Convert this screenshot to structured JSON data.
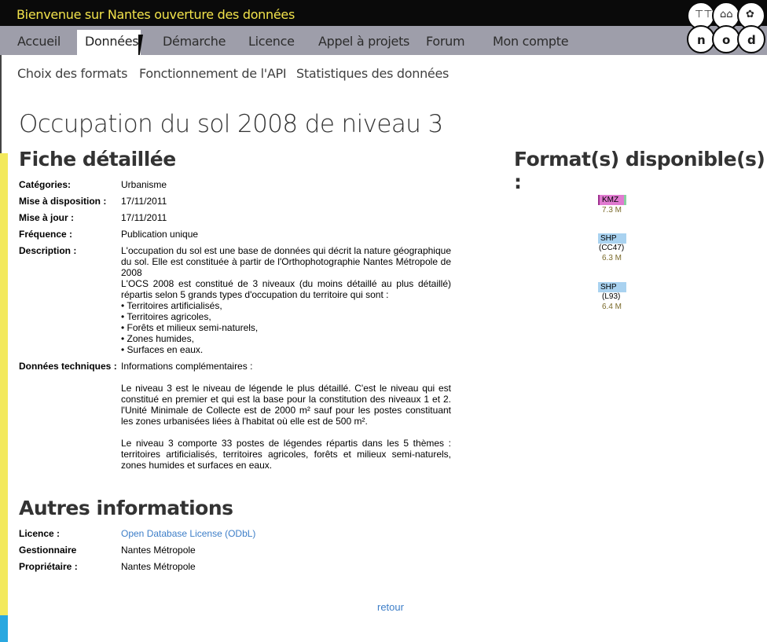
{
  "header": {
    "site_title": "Bienvenue sur Nantes ouverture des données",
    "logo_letters": [
      "n",
      "o",
      "d"
    ]
  },
  "nav": {
    "items": [
      {
        "label": "Accueil"
      },
      {
        "label": "Données",
        "active": true
      },
      {
        "label": "Démarche"
      },
      {
        "label": "Licence"
      },
      {
        "label": "Appel à projets"
      },
      {
        "label": "Forum"
      },
      {
        "label": "Mon compte"
      }
    ]
  },
  "subnav": {
    "items": [
      {
        "label": "Choix des formats"
      },
      {
        "label": "Fonctionnement de l'API"
      },
      {
        "label": "Statistiques des données"
      }
    ]
  },
  "page": {
    "title": "Occupation du sol 2008 de niveau 3",
    "detail_heading": "Fiche détaillée",
    "formats_heading": "Format(s) disponible(s) :",
    "other_heading": "Autres informations"
  },
  "details": {
    "categories_label": "Catégories:",
    "categories_value": "Urbanisme",
    "mise_disposition_label": "Mise à disposition :",
    "mise_disposition_value": "17/11/2011",
    "mise_a_jour_label": "Mise à jour :",
    "mise_a_jour_value": "17/11/2011",
    "frequence_label": "Fréquence :",
    "frequence_value": "Publication unique",
    "description_label": "Description :",
    "description_p1": "L'occupation du sol est une base de données qui décrit la nature géographique du sol. Elle est constituée à partir de l'Orthophotographie Nantes Métropole de 2008",
    "description_p2": "L'OCS 2008 est constitué de 3 niveaux (du moins détaillé au plus détaillé) répartis selon 5 grands types d'occupation du territoire qui sont :",
    "description_list": [
      "• Territoires artificialisés,",
      "• Territoires agricoles,",
      "• Forêts et milieux semi-naturels,",
      "• Zones humides,",
      "• Surfaces en eaux."
    ],
    "tech_label": "Données techniques :",
    "tech_intro": "Informations complémentaires :",
    "tech_p1": "Le niveau 3 est le niveau de légende le plus détaillé. C'est le niveau qui est constitué en premier et qui est la base pour la constitution des niveaux 1 et 2. l'Unité Minimale de Collecte est de 2000 m² sauf pour les postes constituant les zones urbanisées liées à l'habitat où elle est de 500 m².",
    "tech_p2": "Le niveau 3 comporte 33 postes de légendes répartis dans les 5 thèmes : territoires artificialisés, territoires agricoles, forêts et milieux semi-naturels, zones humides et surfaces en eaux."
  },
  "other": {
    "licence_label": "Licence :",
    "licence_value": "Open Database License (ODbL)",
    "gestionnaire_label": "Gestionnaire",
    "gestionnaire_value": "Nantes Métropole",
    "proprietaire_label": "Propriétaire :",
    "proprietaire_value": "Nantes Métropole"
  },
  "formats": [
    {
      "name": "KMZ",
      "sub": "",
      "size": "7.3 M",
      "color": "#e07ad0"
    },
    {
      "name": "SHP",
      "sub": "(CC47)",
      "size": "6.3 M",
      "color": "#a9d2f0"
    },
    {
      "name": "SHP",
      "sub": "(L93)",
      "size": "6.4 M",
      "color": "#a9d2f0"
    }
  ],
  "footer": {
    "retour": "retour"
  },
  "colors": {
    "accent_yellow": "#f2e34b",
    "nav_bg": "#9e9eaa",
    "link": "#3d7ec8"
  }
}
